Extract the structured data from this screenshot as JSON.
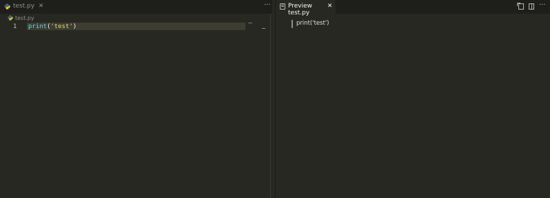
{
  "left_editor": {
    "tab": {
      "label": "test.py",
      "close_glyph": "✕",
      "icon": "python-icon"
    },
    "more_glyph": "···",
    "breadcrumb": {
      "label": "test.py",
      "icon": "python-icon"
    },
    "lines": [
      {
        "number": "1",
        "tokens": {
          "fn": "print",
          "open": "(",
          "str": "'test'",
          "close": ")"
        }
      }
    ]
  },
  "right_preview": {
    "tab": {
      "label": "Preview test.py",
      "close_glyph": "✕",
      "icon": "preview-icon"
    },
    "actions": [
      "open-source-icon",
      "split-editor-icon"
    ],
    "more_glyph": "···",
    "content": "print('test')"
  },
  "colors": {
    "background": "#272822",
    "tabbar": "#1e1f1c",
    "line_highlight": "#3e3d32",
    "function": "#66d9ef",
    "string": "#e6db74",
    "python_blue": "#3572a5",
    "python_yellow": "#ffd43b"
  }
}
